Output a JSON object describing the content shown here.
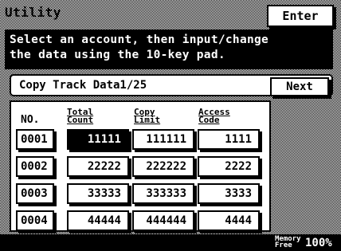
{
  "window": {
    "title": "Utility",
    "enter_label": "Enter"
  },
  "message": {
    "line1": "Select an account, then input/change",
    "line2": "the data using the 10-key pad."
  },
  "header": {
    "label": "Copy Track Data1/25",
    "next_label": "Next"
  },
  "table": {
    "columns": {
      "no": "NO.",
      "total_1": "Total",
      "total_2": "Count",
      "copy_1": "Copy",
      "copy_2": "Limit",
      "access_1": "Access",
      "access_2": "Code"
    },
    "rows": [
      {
        "no": "0001",
        "total": "11111",
        "limit": "111111",
        "code": "1111",
        "selected": true
      },
      {
        "no": "0002",
        "total": "22222",
        "limit": "222222",
        "code": "2222"
      },
      {
        "no": "0003",
        "total": "33333",
        "limit": "333333",
        "code": "3333"
      },
      {
        "no": "0004",
        "total": "44444",
        "limit": "444444",
        "code": "4444"
      }
    ]
  },
  "footer": {
    "memory_1": "Memory",
    "memory_2": "Free",
    "memory_value": "100%"
  }
}
